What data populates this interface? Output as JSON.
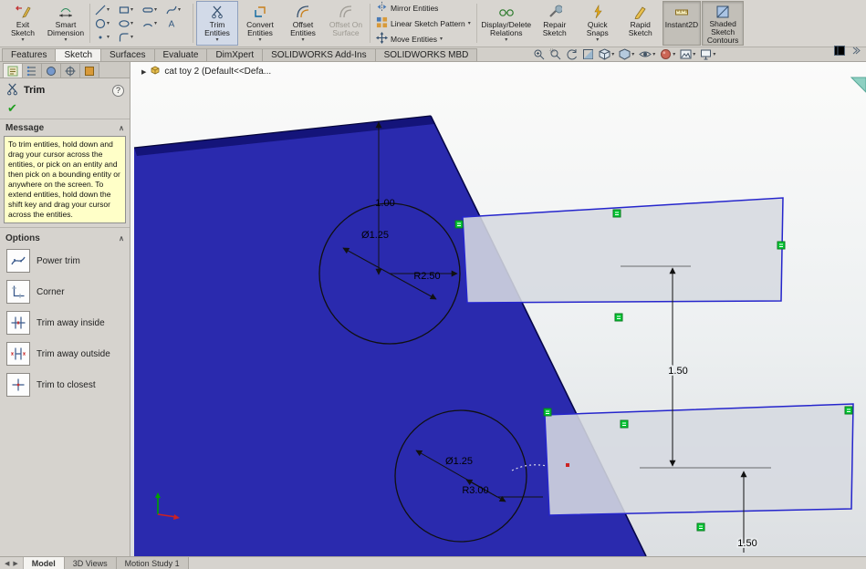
{
  "app": {
    "title_breadcrumb": "cat toy 2  (Default<<Defa..."
  },
  "command_bar": {
    "exit_sketch": "Exit Sketch",
    "smart_dimension": "Smart Dimension",
    "trim_entities": "Trim Entities",
    "convert_entities": "Convert Entities",
    "offset_entities": "Offset Entities",
    "offset_on_surface": "Offset On Surface",
    "mirror_entities": "Mirror Entities",
    "linear_sketch_pattern": "Linear Sketch Pattern",
    "move_entities": "Move Entities",
    "display_delete_relations": "Display/Delete Relations",
    "repair_sketch": "Repair Sketch",
    "quick_snaps": "Quick Snaps",
    "rapid_sketch": "Rapid Sketch",
    "instant2d": "Instant2D",
    "shaded_sketch_contours": "Shaded Sketch Contours"
  },
  "sketch_tool_icons": [
    "line",
    "rectangle",
    "slot",
    "spline",
    "circle",
    "ellipse",
    "arc",
    "text",
    "point",
    "fillet"
  ],
  "hud_icons": [
    "zoom-to-fit",
    "zoom-to-area",
    "previous-view",
    "section-view",
    "view-orientation",
    "display-style",
    "hide-show-items",
    "edit-appearance",
    "apply-scene",
    "view-settings"
  ],
  "ribbon_tabs": [
    "Features",
    "Sketch",
    "Surfaces",
    "Evaluate",
    "DimXpert",
    "SOLIDWORKS Add-Ins",
    "SOLIDWORKS MBD"
  ],
  "property_manager": {
    "title": "Trim",
    "message_header": "Message",
    "message": "To trim entities, hold down and drag your cursor across the entities, or pick on an entity and then pick on a bounding entity or anywhere on the screen.  To extend entities, hold down the shift key and drag your cursor across the entities.",
    "options_header": "Options",
    "options": [
      "Power trim",
      "Corner",
      "Trim away inside",
      "Trim away outside",
      "Trim to closest"
    ]
  },
  "dimensions": {
    "top_height": "1.00",
    "top_diameter": "Ø1.25",
    "top_radius": "R2.50",
    "tab_gap": "1.50",
    "bottom_diameter": "Ø1.25",
    "bottom_radius": "R3.00",
    "bottom_gap": "1.50"
  },
  "bottom_tabs": [
    "Model",
    "3D Views",
    "Motion Study 1"
  ],
  "glyphs": {
    "caret_down": "▾",
    "check": "✔",
    "help": "?",
    "breadcrumb_arrow": "▶",
    "nav_prev": "◀",
    "nav_next": "▶",
    "chevron_up": "∧"
  },
  "colors": {
    "part_blue": "#2a2aae",
    "selection_blue": "#2525cc",
    "relation_green": "#00c832",
    "message_yellow": "#ffffc8"
  }
}
